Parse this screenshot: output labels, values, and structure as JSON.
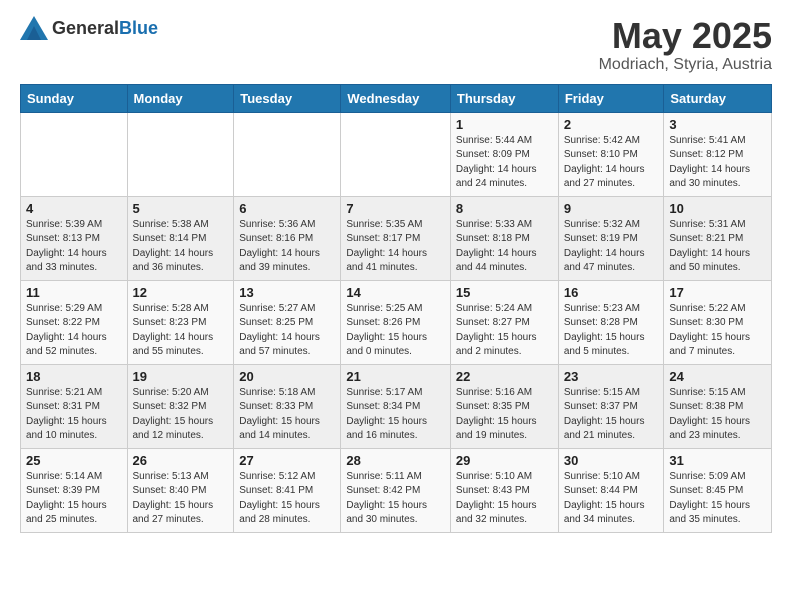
{
  "header": {
    "logo_general": "General",
    "logo_blue": "Blue",
    "month": "May 2025",
    "location": "Modriach, Styria, Austria"
  },
  "weekdays": [
    "Sunday",
    "Monday",
    "Tuesday",
    "Wednesday",
    "Thursday",
    "Friday",
    "Saturday"
  ],
  "weeks": [
    [
      {
        "day": "",
        "info": ""
      },
      {
        "day": "",
        "info": ""
      },
      {
        "day": "",
        "info": ""
      },
      {
        "day": "",
        "info": ""
      },
      {
        "day": "1",
        "info": "Sunrise: 5:44 AM\nSunset: 8:09 PM\nDaylight: 14 hours\nand 24 minutes."
      },
      {
        "day": "2",
        "info": "Sunrise: 5:42 AM\nSunset: 8:10 PM\nDaylight: 14 hours\nand 27 minutes."
      },
      {
        "day": "3",
        "info": "Sunrise: 5:41 AM\nSunset: 8:12 PM\nDaylight: 14 hours\nand 30 minutes."
      }
    ],
    [
      {
        "day": "4",
        "info": "Sunrise: 5:39 AM\nSunset: 8:13 PM\nDaylight: 14 hours\nand 33 minutes."
      },
      {
        "day": "5",
        "info": "Sunrise: 5:38 AM\nSunset: 8:14 PM\nDaylight: 14 hours\nand 36 minutes."
      },
      {
        "day": "6",
        "info": "Sunrise: 5:36 AM\nSunset: 8:16 PM\nDaylight: 14 hours\nand 39 minutes."
      },
      {
        "day": "7",
        "info": "Sunrise: 5:35 AM\nSunset: 8:17 PM\nDaylight: 14 hours\nand 41 minutes."
      },
      {
        "day": "8",
        "info": "Sunrise: 5:33 AM\nSunset: 8:18 PM\nDaylight: 14 hours\nand 44 minutes."
      },
      {
        "day": "9",
        "info": "Sunrise: 5:32 AM\nSunset: 8:19 PM\nDaylight: 14 hours\nand 47 minutes."
      },
      {
        "day": "10",
        "info": "Sunrise: 5:31 AM\nSunset: 8:21 PM\nDaylight: 14 hours\nand 50 minutes."
      }
    ],
    [
      {
        "day": "11",
        "info": "Sunrise: 5:29 AM\nSunset: 8:22 PM\nDaylight: 14 hours\nand 52 minutes."
      },
      {
        "day": "12",
        "info": "Sunrise: 5:28 AM\nSunset: 8:23 PM\nDaylight: 14 hours\nand 55 minutes."
      },
      {
        "day": "13",
        "info": "Sunrise: 5:27 AM\nSunset: 8:25 PM\nDaylight: 14 hours\nand 57 minutes."
      },
      {
        "day": "14",
        "info": "Sunrise: 5:25 AM\nSunset: 8:26 PM\nDaylight: 15 hours\nand 0 minutes."
      },
      {
        "day": "15",
        "info": "Sunrise: 5:24 AM\nSunset: 8:27 PM\nDaylight: 15 hours\nand 2 minutes."
      },
      {
        "day": "16",
        "info": "Sunrise: 5:23 AM\nSunset: 8:28 PM\nDaylight: 15 hours\nand 5 minutes."
      },
      {
        "day": "17",
        "info": "Sunrise: 5:22 AM\nSunset: 8:30 PM\nDaylight: 15 hours\nand 7 minutes."
      }
    ],
    [
      {
        "day": "18",
        "info": "Sunrise: 5:21 AM\nSunset: 8:31 PM\nDaylight: 15 hours\nand 10 minutes."
      },
      {
        "day": "19",
        "info": "Sunrise: 5:20 AM\nSunset: 8:32 PM\nDaylight: 15 hours\nand 12 minutes."
      },
      {
        "day": "20",
        "info": "Sunrise: 5:18 AM\nSunset: 8:33 PM\nDaylight: 15 hours\nand 14 minutes."
      },
      {
        "day": "21",
        "info": "Sunrise: 5:17 AM\nSunset: 8:34 PM\nDaylight: 15 hours\nand 16 minutes."
      },
      {
        "day": "22",
        "info": "Sunrise: 5:16 AM\nSunset: 8:35 PM\nDaylight: 15 hours\nand 19 minutes."
      },
      {
        "day": "23",
        "info": "Sunrise: 5:15 AM\nSunset: 8:37 PM\nDaylight: 15 hours\nand 21 minutes."
      },
      {
        "day": "24",
        "info": "Sunrise: 5:15 AM\nSunset: 8:38 PM\nDaylight: 15 hours\nand 23 minutes."
      }
    ],
    [
      {
        "day": "25",
        "info": "Sunrise: 5:14 AM\nSunset: 8:39 PM\nDaylight: 15 hours\nand 25 minutes."
      },
      {
        "day": "26",
        "info": "Sunrise: 5:13 AM\nSunset: 8:40 PM\nDaylight: 15 hours\nand 27 minutes."
      },
      {
        "day": "27",
        "info": "Sunrise: 5:12 AM\nSunset: 8:41 PM\nDaylight: 15 hours\nand 28 minutes."
      },
      {
        "day": "28",
        "info": "Sunrise: 5:11 AM\nSunset: 8:42 PM\nDaylight: 15 hours\nand 30 minutes."
      },
      {
        "day": "29",
        "info": "Sunrise: 5:10 AM\nSunset: 8:43 PM\nDaylight: 15 hours\nand 32 minutes."
      },
      {
        "day": "30",
        "info": "Sunrise: 5:10 AM\nSunset: 8:44 PM\nDaylight: 15 hours\nand 34 minutes."
      },
      {
        "day": "31",
        "info": "Sunrise: 5:09 AM\nSunset: 8:45 PM\nDaylight: 15 hours\nand 35 minutes."
      }
    ]
  ]
}
